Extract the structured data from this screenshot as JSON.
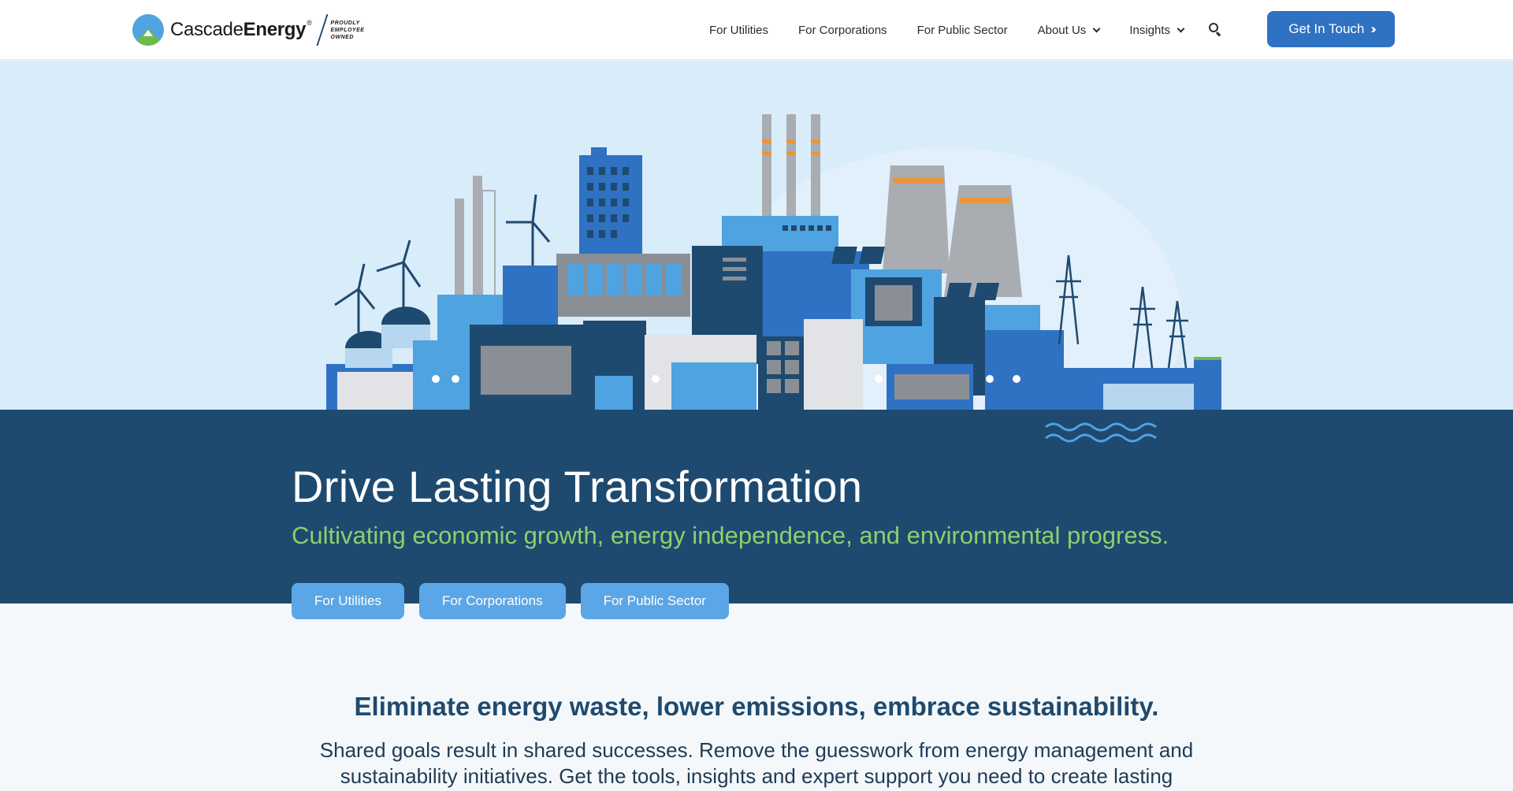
{
  "header": {
    "logo": {
      "brand_light": "Cascade",
      "brand_bold": "Energy",
      "registered": "®",
      "tagline": [
        "PROUDLY",
        "EMPLOYEE",
        "OWNED"
      ]
    },
    "nav": [
      {
        "label": "For Utilities",
        "dropdown": false
      },
      {
        "label": "For Corporations",
        "dropdown": false
      },
      {
        "label": "For Public Sector",
        "dropdown": false
      },
      {
        "label": "About Us",
        "dropdown": true
      },
      {
        "label": "Insights",
        "dropdown": true
      }
    ],
    "search_icon": "search-icon",
    "cta_label": "Get In Touch",
    "cta_icon": "double-chevron-right-icon"
  },
  "hero": {
    "title": "Drive Lasting Transformation",
    "subtitle": "Cultivating economic growth, energy independence, and environmental progress.",
    "buttons": [
      "For Utilities",
      "For Corporations",
      "For Public Sector"
    ]
  },
  "section": {
    "title": "Eliminate energy waste, lower emissions, embrace sustainability.",
    "body": "Shared goals result in shared successes. Remove the guesswork from energy management and sustainability initiatives. Get the tools, insights and expert support you need to create lasting"
  },
  "colors": {
    "accent": "#2f72c4",
    "hero_band": "#1e4a70",
    "hero_sky": "#d9ecfa",
    "subtitle_green": "#8cd06e",
    "pill_blue": "#5ba6e6"
  }
}
